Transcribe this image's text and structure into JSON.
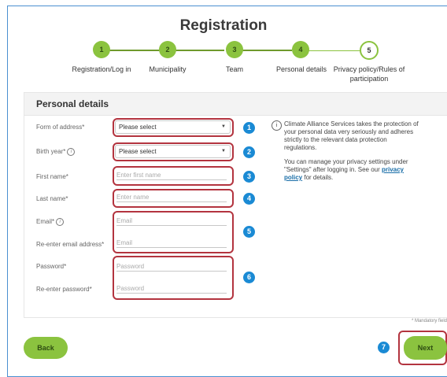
{
  "page": {
    "title": "Registration"
  },
  "steps": [
    {
      "number": "1",
      "label": "Registration/Log in"
    },
    {
      "number": "2",
      "label": "Municipality"
    },
    {
      "number": "3",
      "label": "Team"
    },
    {
      "number": "4",
      "label": "Personal details"
    },
    {
      "number": "5",
      "label": "Privacy policy/Rules of participation"
    }
  ],
  "section": {
    "title": "Personal details"
  },
  "form": {
    "address_label": "Form of address*",
    "address_value": "Please select",
    "birth_label": "Birth year*",
    "birth_value": "Please select",
    "first_label": "First name*",
    "first_placeholder": "Enter first name",
    "last_label": "Last name*",
    "last_placeholder": "Enter name",
    "email_label": "Email*",
    "email_placeholder": "Email",
    "email2_label": "Re-enter email address*",
    "email2_placeholder": "Email",
    "pw_label": "Password*",
    "pw_placeholder": "Password",
    "pw2_label": "Re-enter password*",
    "pw2_placeholder": "Password"
  },
  "badges": [
    "1",
    "2",
    "3",
    "4",
    "5",
    "6",
    "7"
  ],
  "info": {
    "para1": "Climate Alliance Services takes the protection of your personal data very seriously and adheres strictly to the relevant data protection regulations.",
    "para2_prefix": "You can manage your privacy settings under \"Settings\" after logging in. See our ",
    "para2_link": "privacy policy",
    "para2_suffix": " for details."
  },
  "mandatory_note": "* Mandatory field",
  "buttons": {
    "back": "Back",
    "next": "Next"
  },
  "colors": {
    "accent_green": "#8bc33f",
    "badge_blue": "#1a8ad4",
    "highlight_red": "#b3343f"
  },
  "icons": {
    "info": "info-icon",
    "dropdown": "chevron-down-icon"
  }
}
